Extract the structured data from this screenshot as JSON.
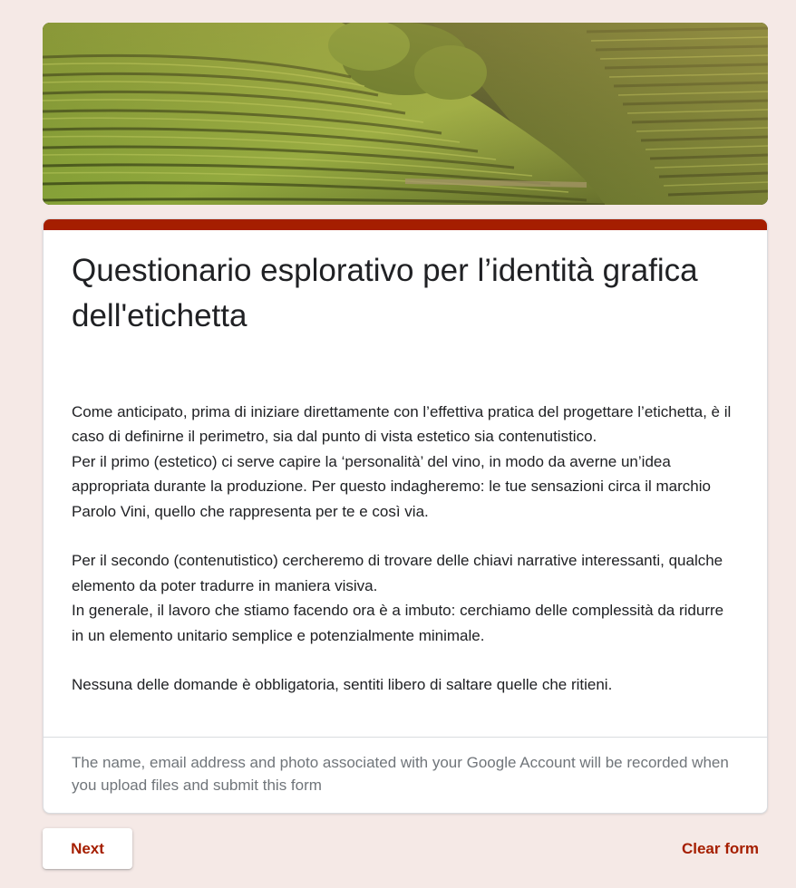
{
  "banner": {
    "image_name": "vineyard-terraces-header-image"
  },
  "colors": {
    "accent": "#a51e00",
    "page_background": "#f5e9e6",
    "card_background": "#ffffff",
    "text": "#202124",
    "muted_text": "#70757a"
  },
  "form": {
    "title": "Questionario esplorativo per l’identità grafica dell'etichetta",
    "description": [
      "Come anticipato, prima di iniziare direttamente con l’effettiva pratica del progettare l’etichetta, è il caso di definirne il perimetro, sia dal punto di vista estetico sia contenutistico.",
      "Per il primo (estetico) ci serve capire la ‘personalità’ del vino, in modo da averne un’idea appropriata durante la produzione. Per questo indagheremo: le tue sensazioni circa il marchio Parolo Vini, quello che rappresenta per te e così via.",
      "",
      "Per il secondo (contenutistico) cercheremo di trovare delle chiavi narrative interessanti, qualche elemento da poter tradurre in maniera visiva.",
      "In generale, il lavoro che stiamo facendo ora è a imbuto: cerchiamo delle complessità da ridurre in un elemento unitario semplice e potenzialmente minimale.",
      "",
      "Nessuna delle domande è obbligatoria, sentiti libero di saltare quelle che ritieni."
    ],
    "account_note": "The name, email address and photo associated with your Google Account will be recorded when you upload files and submit this form"
  },
  "footer": {
    "next_label": "Next",
    "clear_label": "Clear form"
  }
}
